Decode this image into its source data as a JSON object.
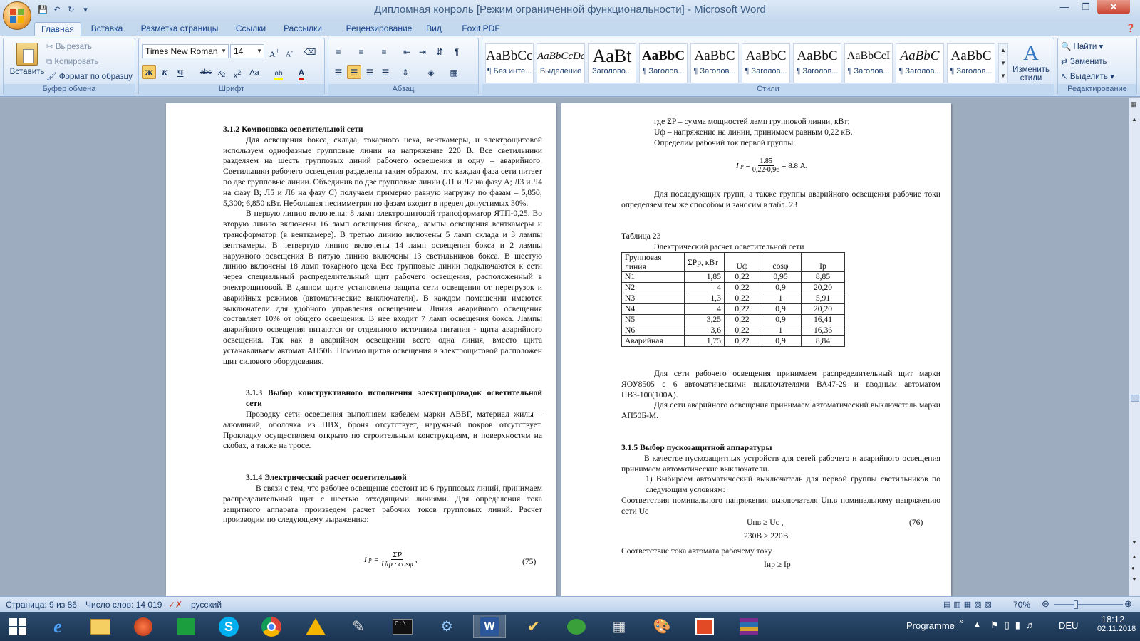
{
  "window": {
    "title": "Дипломная конроль [Режим ограниченной функциональности] - Microsoft Word"
  },
  "tabs": [
    "Главная",
    "Вставка",
    "Разметка страницы",
    "Ссылки",
    "Рассылки",
    "Рецензирование",
    "Вид",
    "Foxit PDF"
  ],
  "ribbon": {
    "clipboard": {
      "paste": "Вставить",
      "cut": "Вырезать",
      "copy": "Копировать",
      "format_painter": "Формат по образцу",
      "label": "Буфер обмена"
    },
    "font": {
      "name": "Times New Roman",
      "size": "14",
      "label": "Шрифт"
    },
    "paragraph": {
      "label": "Абзац"
    },
    "styles": {
      "label": "Стили",
      "items": [
        {
          "sample": "AaBbCcI",
          "name": "¶ Без инте..."
        },
        {
          "sample": "AaBbCcDd",
          "name": "Выделение"
        },
        {
          "sample": "AaBt",
          "name": "Заголово..."
        },
        {
          "sample": "AaBbC",
          "name": "¶ Заголов..."
        },
        {
          "sample": "AaBbC",
          "name": "¶ Заголов..."
        },
        {
          "sample": "AaBbC",
          "name": "¶ Заголов..."
        },
        {
          "sample": "AaBbC",
          "name": "¶ Заголов..."
        },
        {
          "sample": "AaBbCcI",
          "name": "¶ Заголов..."
        },
        {
          "sample": "AaBbC",
          "name": "¶ Заголов..."
        },
        {
          "sample": "AaBbC",
          "name": "¶ Заголов..."
        }
      ],
      "change_styles": "Изменить стили"
    },
    "editing": {
      "find": "Найти",
      "replace": "Заменить",
      "select": "Выделить",
      "label": "Редактирование"
    }
  },
  "page1": {
    "h312": "3.1.2 Компоновка осветительной сети",
    "p1": "Для освещения бокса, склада, токарного цеха, венткамеры, и электрощитовой используем однофазные групповые линии на напряжение 220 В. Все светильники разделяем на шесть групповых линий рабочего освещения и одну – аварийного. Светильники рабочего освещения разделены таким образом, что каждая фаза сети питает по две групповые линии. Объединив по две групповые линии (Л1 и Л2 на фазу А; Л3 и Л4 на фазу В; Л5 и Л6 на фазу С) получаем примерно равную нагрузку по фазам – 5,850; 5,300; 6,850 кВт. Небольшая несимметрия по фазам входит в предел допустимых 30%.",
    "p2": "В первую линию включены: 8 ламп электрощитовой трансформатор ЯТП-0,25. Во вторую линию включены 16 ламп освещения бокса,, лампы освещения венткамеры и трансформатор (в венткамере). В третью линию включены 5 ламп склада и 3 лампы венткамеры. В четвертую линию включены 14 ламп освещения бокса и 2 лампы наружного освещения В пятую линию включены 13 светильников бокса. В шестую линию включены 18 ламп токарного цеха Все групповые линии подключаются к сети через специальный распределительный щит рабочего освещения, расположенный в электрощитовой. В данном щите установлена защита сети освещения от перегрузок и аварийных режимов (автоматические выключатели). В каждом помещении имеются выключатели для удобного управления освещением. Линия аварийного освещения составляет 10% от общего освещения. В нее входит 7 ламп освещения бокса. Лампы аварийного освещения питаются от отдельного источника питания - щита аварийного освещения. Так как в аварийном освещении всего одна линия, вместо щита устанавливаем автомат АП50Б. Помимо щитов освещения в электрощитовой расположен щит силового оборудования.",
    "h313": "3.1.3 Выбор конструктивного исполнения электропроводок осветительной сети",
    "p3": "Проводку сети освещения выполняем кабелем марки АВВГ, материал жилы – алюминий, оболочка из ПВХ, броня отсутствует, наружный покров отсутствует. Прокладку осуществляем открыто по строительным конструкциям, и поверхностям на скобах, а также на тросе.",
    "h314": "3.1.4 Электрический расчет осветительной",
    "p4": "В связи с тем, что рабочее освещение состоит из 6 групповых линий, принимаем распределительный щит с шестью отходящими линиями. Для определения тока защитного аппарата произведем расчет рабочих токов групповых линий. Расчет производим по следующему выражению:",
    "f75_lhs": "I",
    "f75_sub": "р",
    "f75_num": "ΣP",
    "f75_den": "Uф · cosφ",
    "f75_no": "(75)"
  },
  "page2": {
    "l1": "где ΣP – сумма мощностей ламп групповой линии, кВт;",
    "l2": "Uф – напряжение на линии, принимаем равным 0,22 кВ.",
    "l3": "Определим рабочий ток первой группы:",
    "f_num": "1.85",
    "f_den": "0,22·0,96",
    "f_res": "= 8.8 А.",
    "p_next": "Для последующих групп, а также группы аварийного освещения рабочие токи определяем тем же способом и заносим в табл. 23",
    "table_no": "Таблица 23",
    "table_title": "Электрический расчет осветительной сети",
    "table_headers": [
      "Групповая линия",
      "ΣPр, кВт",
      "Uф",
      "cosφ",
      "Iр"
    ],
    "table_rows": [
      [
        "N1",
        "1,85",
        "0,22",
        "0,95",
        "8,85"
      ],
      [
        "N2",
        "4",
        "0,22",
        "0,9",
        "20,20"
      ],
      [
        "N3",
        "1,3",
        "0,22",
        "1",
        "5,91"
      ],
      [
        "N4",
        "4",
        "0,22",
        "0,9",
        "20,20"
      ],
      [
        "N5",
        "3,25",
        "0,22",
        "0,9",
        "16,41"
      ],
      [
        "N6",
        "3,6",
        "0,22",
        "1",
        "16,36"
      ],
      [
        "Аварийная",
        "1,75",
        "0,22",
        "0,9",
        "8,84"
      ]
    ],
    "p5": "Для сети рабочего освещения принимаем распределительный щит марки ЯОУ8505 с 6 автоматическими выключателями ВА47-29 и вводным автоматом ПВЗ-100(100А).",
    "p6": "Для сети аварийного освещения принимаем автоматический выключатель марки АП50Б-М.",
    "h315": "3.1.5 Выбор пускозащитной аппаратуры",
    "p7": "В качестве пускозащитных устройств для сетей рабочего и аварийного освещения принимаем автоматические выключатели.",
    "p8": "1) Выбираем автоматический выключатель для первой группы светильников по следующим условиям:",
    "p9": "Соответствия номинального напряжения выключателя Uн.в номинальному напряжению сети Uс",
    "eq1": "Uнв ≥ Uс ,",
    "eq_no": "(76)",
    "eq2": "230В ≥ 220В.",
    "p10": "Соответствие тока автомата рабочему току",
    "eq3": "Iнр ≥ Iр"
  },
  "status": {
    "page": "Страница: 9 из 86",
    "words": "Число слов: 14 019",
    "lang": "русский",
    "zoom": "70%"
  },
  "taskbar": {
    "programme": "Programme",
    "lang": "DEU",
    "time": "18:12",
    "date": "02.11.2018"
  }
}
